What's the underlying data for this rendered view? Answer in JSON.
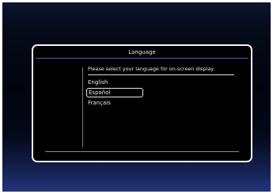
{
  "menu": {
    "title": "Language",
    "prompt": "Please select your language for on-screen display.",
    "options": [
      {
        "label": "English",
        "selected": false
      },
      {
        "label": "Español",
        "selected": true
      },
      {
        "label": "Français",
        "selected": false
      }
    ]
  },
  "colors": {
    "accent": "#4a5fc0",
    "text": "#e6e6e6",
    "border": "#f2f2f2"
  }
}
